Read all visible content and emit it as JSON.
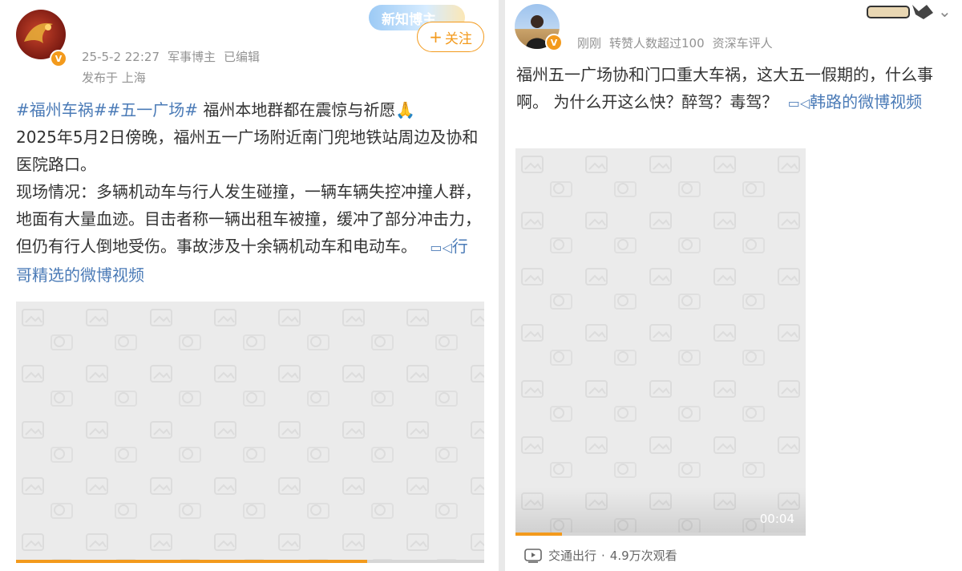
{
  "left_post": {
    "avatar_icon": "user-avatar-red-dragon",
    "verified_icon": "verified-v-badge",
    "badge_text": "新知博主",
    "follow_label": "关注",
    "date": "25-5-2 22:27",
    "author": "军事博主",
    "edited": "已编辑",
    "location": "发布于 上海",
    "tag1": "#福州车祸#",
    "tag2": "#五一广场#",
    "line1_rest": " 福州本地群都在震惊与祈愿",
    "emoji": "🙏",
    "p1": "2025年5月2日傍晚，福州五一广场附近南门兜地铁站周边及协和医院路口。",
    "p2": "现场情况：多辆机动车与行人发生碰撞，一辆车辆失控冲撞人群，地面有大量血迹。目击者称一辆出租车被撞，缓冲了部分冲击力，但仍有行人倒地受伤。事故涉及十余辆机动车和电动车。",
    "video_link": "行哥精选的微博视频",
    "video_progress": 0.75
  },
  "right_post": {
    "avatar_icon": "user-avatar-person",
    "verified_icon": "verified-v-badge",
    "time": "刚刚",
    "stat": "转赞人数超过100",
    "author_desc": "资深车评人",
    "text": "福州五一广场协和门口重大车祸，这大五一假期的，什么事啊。 为什么开这么快？醉驾？毒驾？",
    "video_link": "韩路的微博视频",
    "duration": "00:04",
    "video_progress": 0.16,
    "channel": "交通出行",
    "views": "4.9万次观看",
    "channel_icon": "video-play-icon"
  }
}
